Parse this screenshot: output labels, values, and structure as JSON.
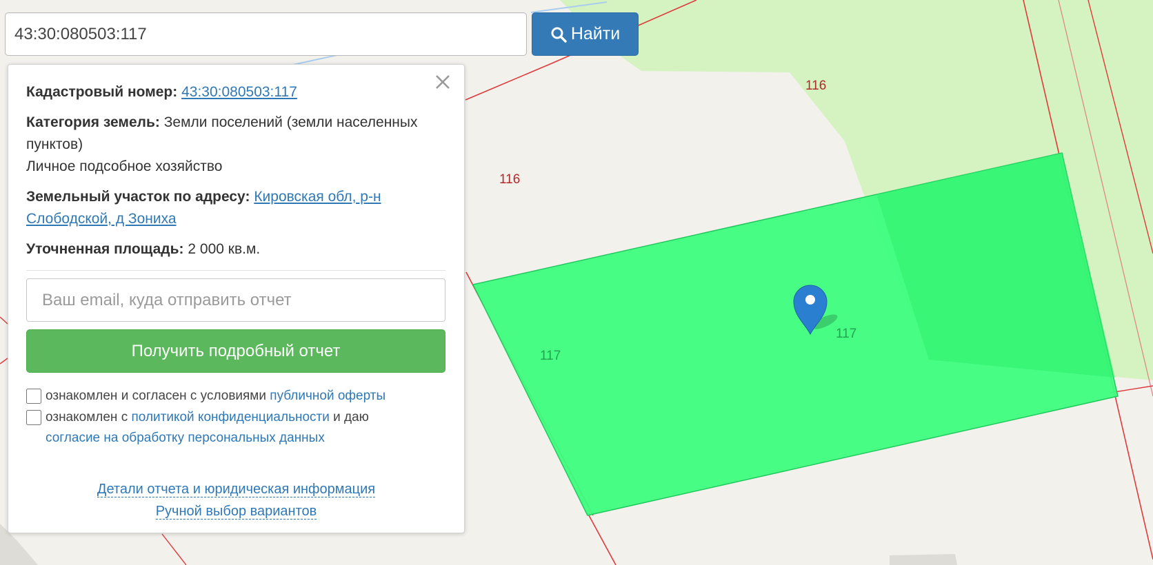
{
  "search": {
    "value": "43:30:080503:117",
    "button_label": "Найти"
  },
  "colors": {
    "plot_fill": "#3dfd7e",
    "plot_border": "#22c85e",
    "boundary_line": "#e0393c",
    "forest": "#d4f3c0",
    "map_bg": "#f2f1ec",
    "accent_blue": "#337ab7",
    "report_green": "#5cb85c"
  },
  "map": {
    "labels": [
      {
        "text": "116"
      },
      {
        "text": "116"
      },
      {
        "text": "117"
      },
      {
        "text": "117"
      }
    ],
    "marker_icon": "map-pin-icon"
  },
  "popup": {
    "cadastral_label": "Кадастровый номер:",
    "cadastral_value": "43:30:080503:117",
    "category_label": "Категория земель:",
    "category_value": "Земли поселений (земли населенных пунктов)",
    "usage": "Личное подсобное хозяйство",
    "address_label": "Земельный участок по адресу:",
    "address_value": "Кировская обл, р-н Слободской, д Зониха",
    "area_label": "Уточненная площадь:",
    "area_value": "2 000 кв.м.",
    "email_placeholder": "Ваш email, куда отправить отчет",
    "report_button": "Получить подробный отчет",
    "offer": {
      "prefix": "ознакомлен и согласен с условиями",
      "link": "публичной оферты"
    },
    "privacy": {
      "prefix": "ознакомлен с",
      "link1": "политикой конфиденциальности",
      "middle": "и даю",
      "link2": "согласие на обработку персональных данных"
    },
    "details_link": "Детали отчета и юридическая информация",
    "manual_link": "Ручной выбор вариантов"
  }
}
